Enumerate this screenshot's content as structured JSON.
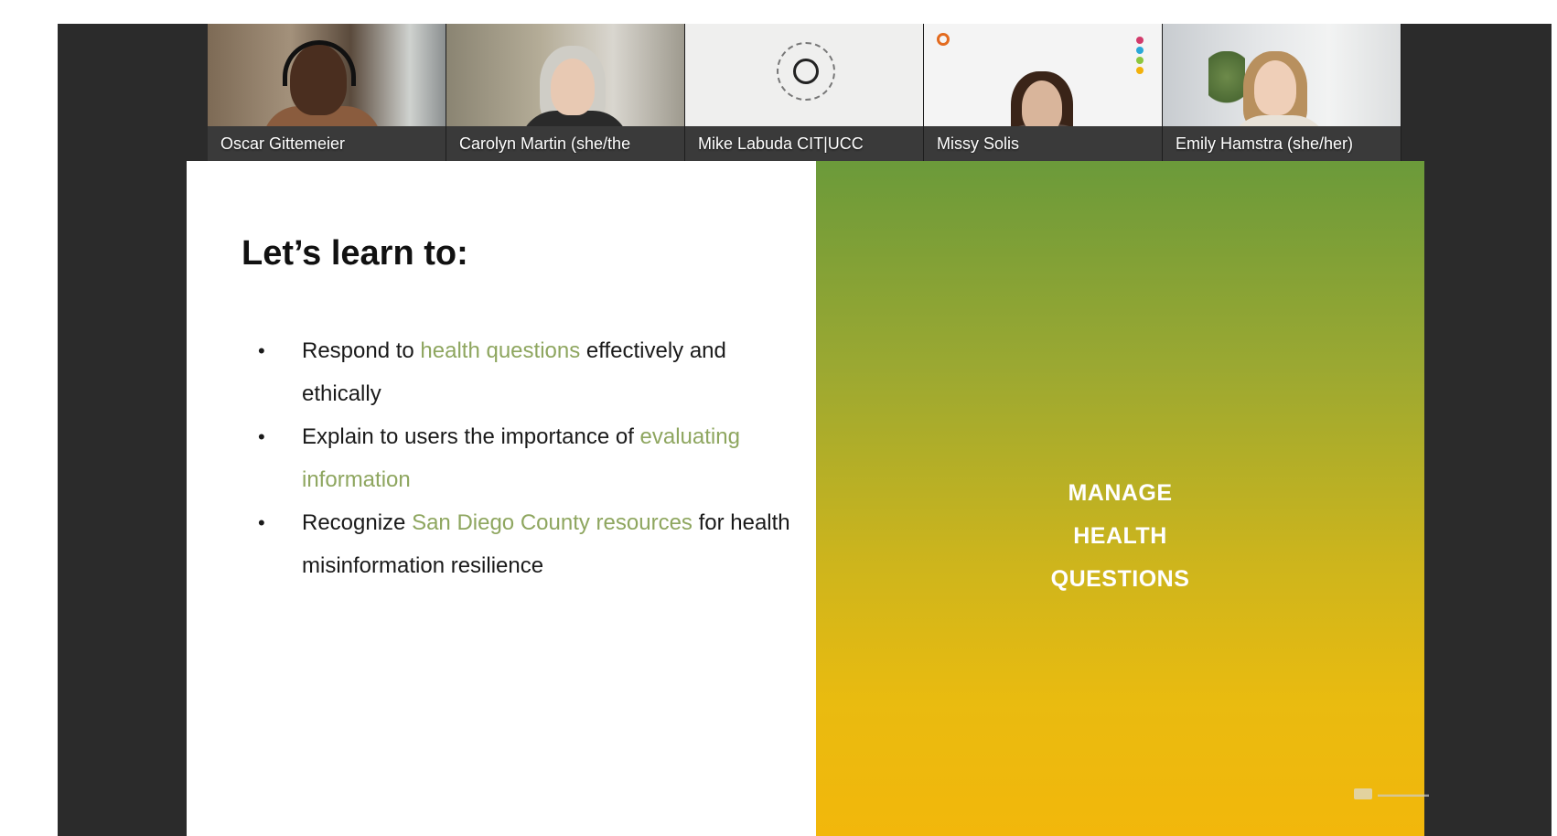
{
  "participants": [
    {
      "name": "Oscar Gittemeier"
    },
    {
      "name": "Carolyn Martin (she/the"
    },
    {
      "name": "Mike Labuda CIT|UCC"
    },
    {
      "name": "Missy Solis"
    },
    {
      "name": "Emily Hamstra (she/her)"
    }
  ],
  "slide": {
    "heading": "Let’s learn to:",
    "bullets": [
      {
        "before": "Respond to ",
        "highlight": "health questions",
        "after": " effectively and ethically"
      },
      {
        "before": "Explain to users the importance of ",
        "highlight": "evaluating information",
        "after": ""
      },
      {
        "before": "Recognize ",
        "highlight": "San Diego County resources",
        "after": " for health misinformation resilience"
      }
    ],
    "panel_lines": [
      "MANAGE",
      "HEALTH",
      "QUESTIONS"
    ]
  },
  "colors": {
    "highlight": "#8ea65f",
    "panel_top": "#6b9a3a",
    "panel_bottom": "#f2b70b",
    "frame": "#2b2b2b"
  }
}
